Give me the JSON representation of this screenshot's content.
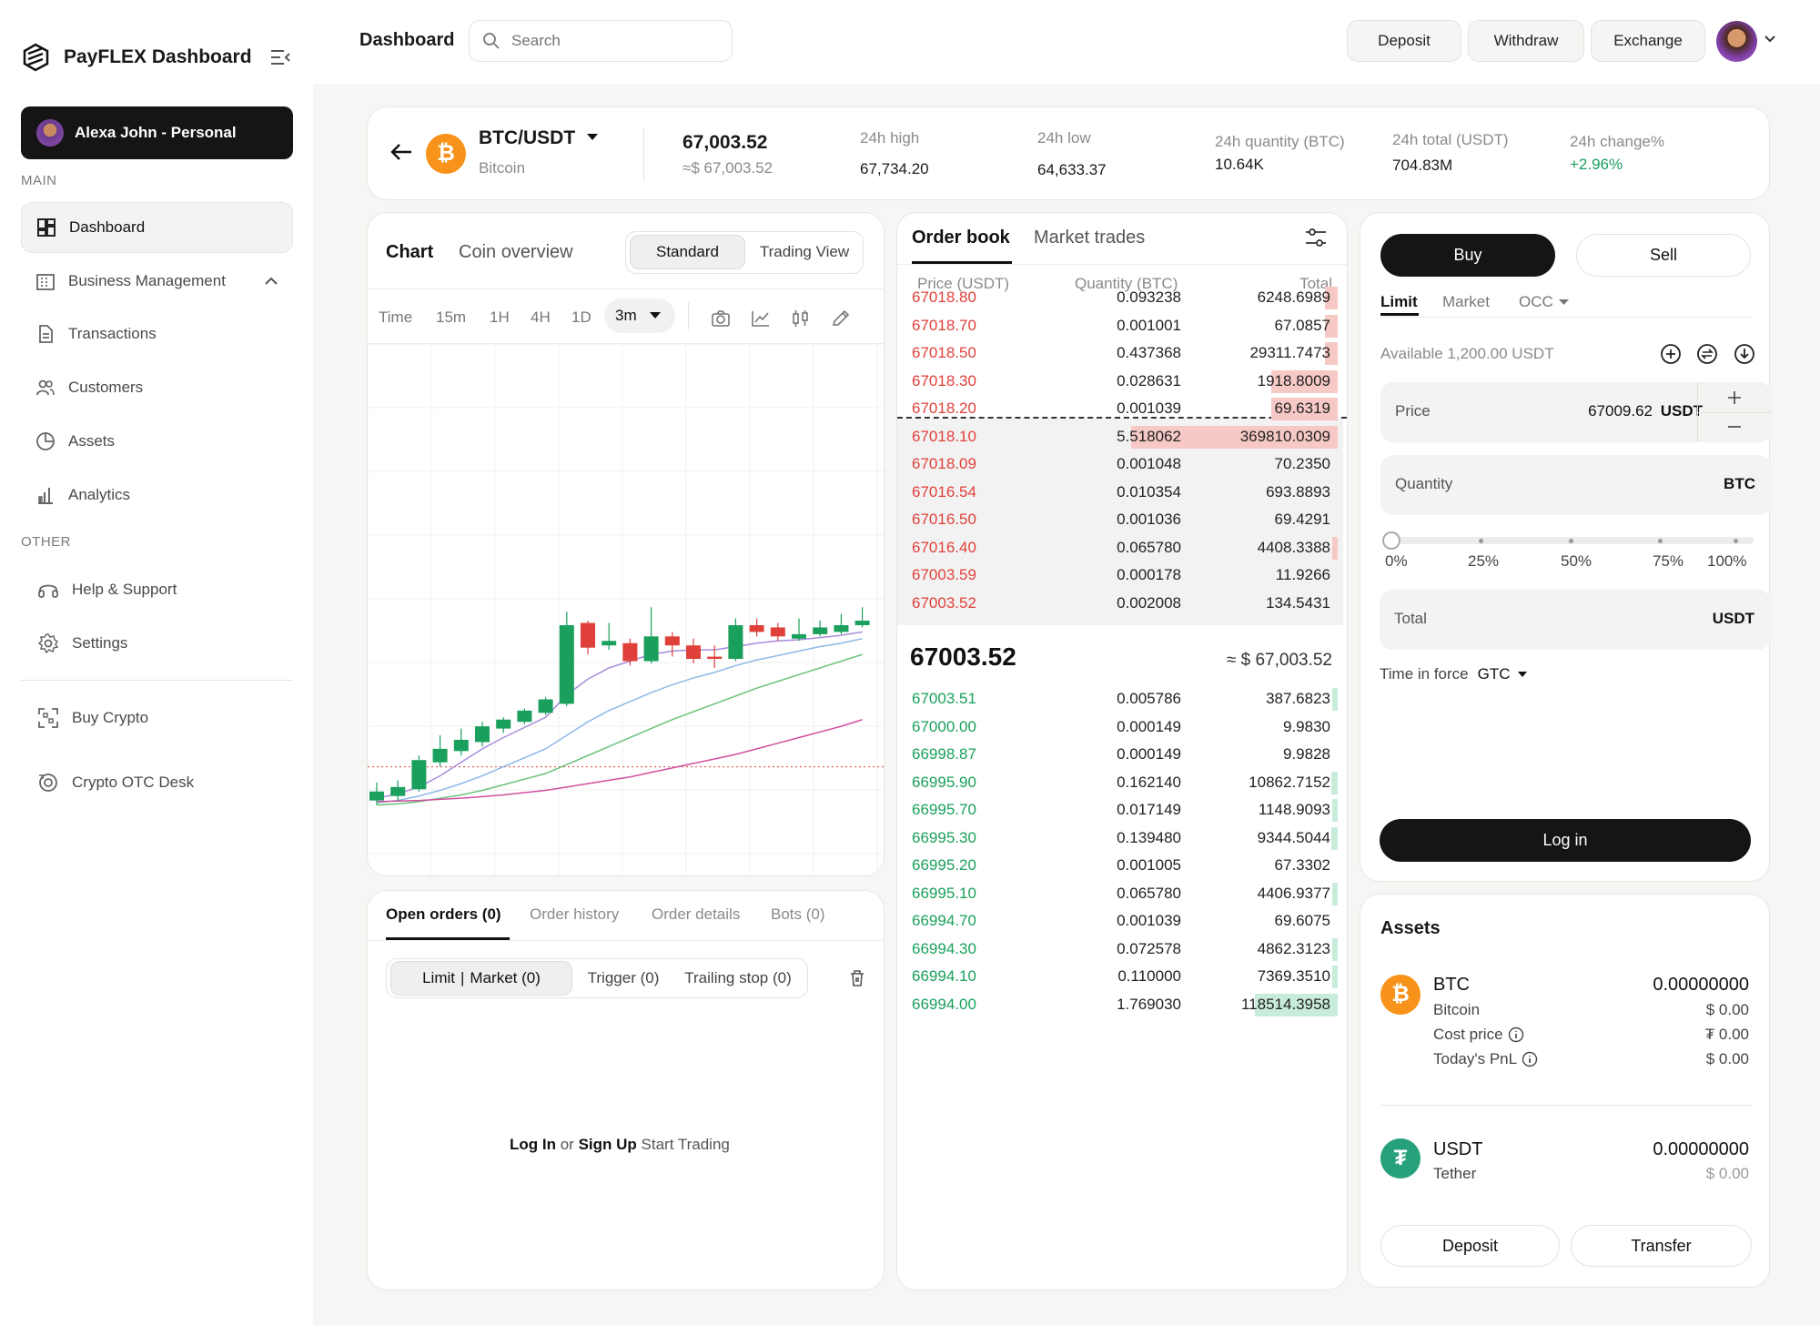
{
  "sidebar": {
    "brand": "PayFLEX Dashboard",
    "profile": "Alexa John - Personal",
    "main_label": "MAIN",
    "items": [
      {
        "label": "Dashboard",
        "icon": "dashboard-icon"
      },
      {
        "label": "Business Management",
        "icon": "building-icon"
      },
      {
        "label": "Transactions",
        "icon": "document-icon"
      },
      {
        "label": "Customers",
        "icon": "users-icon"
      },
      {
        "label": "Assets",
        "icon": "pie-icon"
      },
      {
        "label": "Analytics",
        "icon": "bar-chart-icon"
      }
    ],
    "other_label": "OTHER",
    "other_items": [
      {
        "label": "Help & Support",
        "icon": "headset-icon"
      },
      {
        "label": "Settings",
        "icon": "gear-icon"
      }
    ],
    "extra_items": [
      {
        "label": "Buy Crypto",
        "icon": "scan-icon"
      },
      {
        "label": "Crypto OTC Desk",
        "icon": "otc-icon"
      }
    ]
  },
  "header": {
    "title": "Dashboard",
    "search_placeholder": "Search",
    "deposit": "Deposit",
    "withdraw": "Withdraw",
    "exchange": "Exchange"
  },
  "ticker": {
    "pair": "BTC/USDT",
    "name": "Bitcoin",
    "price": "67,003.52",
    "price_usd": "≈$ 67,003.52",
    "stats": [
      {
        "label": "24h high",
        "value": "67,734.20"
      },
      {
        "label": "24h low",
        "value": "64,633.37"
      },
      {
        "label": "24h quantity (BTC)",
        "value": "10.64K"
      },
      {
        "label": "24h total (USDT)",
        "value": "704.83M"
      },
      {
        "label": "24h change%",
        "value": "+2.96%"
      }
    ]
  },
  "chart_panel": {
    "tab_chart": "Chart",
    "tab_overview": "Coin overview",
    "standard": "Standard",
    "trading_view": "Trading View",
    "timeframes": [
      "Time",
      "15m",
      "1H",
      "4H",
      "1D"
    ],
    "selected_tf": "3m"
  },
  "chart_data": {
    "type": "candlestick",
    "candles": [
      {
        "o": 1.0,
        "c": 1.8,
        "h": 2.6,
        "l": 0.6
      },
      {
        "o": 1.4,
        "c": 2.2,
        "h": 2.8,
        "l": 1.0
      },
      {
        "o": 2.0,
        "c": 4.6,
        "h": 5.0,
        "l": 1.8
      },
      {
        "o": 4.4,
        "c": 5.6,
        "h": 6.8,
        "l": 4.0
      },
      {
        "o": 5.4,
        "c": 6.4,
        "h": 7.4,
        "l": 5.0
      },
      {
        "o": 6.2,
        "c": 7.6,
        "h": 8.0,
        "l": 5.8
      },
      {
        "o": 7.4,
        "c": 8.2,
        "h": 8.4,
        "l": 7.0
      },
      {
        "o": 8.0,
        "c": 9.0,
        "h": 9.2,
        "l": 7.8
      },
      {
        "o": 8.8,
        "c": 10.0,
        "h": 10.2,
        "l": 8.6
      },
      {
        "o": 9.6,
        "c": 16.6,
        "h": 17.8,
        "l": 9.4
      },
      {
        "o": 16.8,
        "c": 14.6,
        "h": 17.0,
        "l": 14.0
      },
      {
        "o": 14.8,
        "c": 15.2,
        "h": 16.8,
        "l": 14.4
      },
      {
        "o": 15.0,
        "c": 13.4,
        "h": 15.4,
        "l": 13.0
      },
      {
        "o": 13.4,
        "c": 15.6,
        "h": 18.2,
        "l": 13.2
      },
      {
        "o": 15.6,
        "c": 14.8,
        "h": 16.0,
        "l": 13.8
      },
      {
        "o": 14.8,
        "c": 13.6,
        "h": 15.4,
        "l": 13.2
      },
      {
        "o": 13.8,
        "c": 13.6,
        "h": 14.8,
        "l": 12.8
      },
      {
        "o": 13.6,
        "c": 16.6,
        "h": 17.2,
        "l": 13.4
      },
      {
        "o": 16.6,
        "c": 16.0,
        "h": 17.2,
        "l": 15.6
      },
      {
        "o": 16.4,
        "c": 15.6,
        "h": 16.8,
        "l": 15.2
      },
      {
        "o": 15.4,
        "c": 15.8,
        "h": 17.2,
        "l": 15.2
      },
      {
        "o": 15.8,
        "c": 16.4,
        "h": 17.0,
        "l": 15.6
      },
      {
        "o": 16.0,
        "c": 16.6,
        "h": 17.6,
        "l": 15.8
      },
      {
        "o": 16.6,
        "c": 17.0,
        "h": 18.2,
        "l": 16.4
      }
    ],
    "ma_series": [
      {
        "color": "#a78bdb",
        "values": [
          1.2,
          1.6,
          2.2,
          3.2,
          4.4,
          5.6,
          6.6,
          7.5,
          8.4,
          10.4,
          11.8,
          12.8,
          13.4,
          14.0,
          14.3,
          14.4,
          14.4,
          14.7,
          15.0,
          15.2,
          15.3,
          15.5,
          15.7,
          16.0
        ]
      },
      {
        "color": "#8fb8e8",
        "values": [
          0.8,
          1.0,
          1.4,
          1.9,
          2.5,
          3.2,
          4.0,
          4.8,
          5.6,
          6.8,
          8.0,
          9.0,
          9.8,
          10.6,
          11.3,
          11.9,
          12.4,
          13.0,
          13.5,
          13.9,
          14.3,
          14.7,
          15.0,
          15.4
        ]
      },
      {
        "color": "#6cc27a",
        "values": [
          0.6,
          0.7,
          0.9,
          1.2,
          1.5,
          1.9,
          2.4,
          2.9,
          3.4,
          4.2,
          5.0,
          5.8,
          6.6,
          7.4,
          8.2,
          8.9,
          9.6,
          10.3,
          11.0,
          11.6,
          12.2,
          12.8,
          13.4,
          14.0
        ]
      },
      {
        "color": "#d14fa0",
        "values": [
          0.9,
          0.95,
          1.0,
          1.1,
          1.2,
          1.35,
          1.5,
          1.7,
          1.9,
          2.2,
          2.5,
          2.8,
          3.1,
          3.5,
          3.9,
          4.3,
          4.7,
          5.1,
          5.6,
          6.1,
          6.6,
          7.1,
          7.6,
          8.2
        ]
      }
    ],
    "price_line": 4.0,
    "ylim": [
      0,
      40
    ]
  },
  "orders_panel": {
    "tabs": [
      "Open orders (0)",
      "Order history",
      "Order details",
      "Bots (0)"
    ],
    "limit": "Limit",
    "market": "Market (0)",
    "trigger": "Trigger (0)",
    "trailing": "Trailing stop (0)",
    "login": "Log In",
    "or": "or",
    "signup": "Sign Up",
    "start": "Start Trading"
  },
  "orderbook": {
    "tab_book": "Order book",
    "tab_trades": "Market trades",
    "col_price": "Price (USDT)",
    "col_qty": "Quantity (BTC)",
    "col_total": "Total",
    "asks": [
      {
        "p": "67018.80",
        "q": "0.093238",
        "t": "6248.6989",
        "depth": 0.03
      },
      {
        "p": "67018.70",
        "q": "0.001001",
        "t": "67.0857",
        "depth": 0.03
      },
      {
        "p": "67018.50",
        "q": "0.437368",
        "t": "29311.7473",
        "depth": 0.03
      },
      {
        "p": "67018.30",
        "q": "0.028631",
        "t": "1918.8009",
        "depth": 0.16
      },
      {
        "p": "67018.20",
        "q": "0.001039",
        "t": "69.6319",
        "depth": 0.16
      },
      {
        "p": "67018.10",
        "q": "5.518062",
        "t": "369810.0309",
        "depth": 0.5
      },
      {
        "p": "67018.09",
        "q": "0.001048",
        "t": "70.2350",
        "depth": 0.0
      },
      {
        "p": "67016.54",
        "q": "0.010354",
        "t": "693.8893",
        "depth": 0.0
      },
      {
        "p": "67016.50",
        "q": "0.001036",
        "t": "69.4291",
        "depth": 0.0
      },
      {
        "p": "67016.40",
        "q": "0.065780",
        "t": "4408.3388",
        "depth": 0.01
      },
      {
        "p": "67003.59",
        "q": "0.000178",
        "t": "11.9266",
        "depth": 0.0
      },
      {
        "p": "67003.52",
        "q": "0.002008",
        "t": "134.5431",
        "depth": 0.0
      }
    ],
    "mid_price": "67003.52",
    "mid_usd": "≈ $ 67,003.52",
    "bids": [
      {
        "p": "67003.51",
        "q": "0.005786",
        "t": "387.6823",
        "depth": 0.005
      },
      {
        "p": "67000.00",
        "q": "0.000149",
        "t": "9.9830",
        "depth": 0.0
      },
      {
        "p": "66998.87",
        "q": "0.000149",
        "t": "9.9828",
        "depth": 0.0
      },
      {
        "p": "66995.90",
        "q": "0.162140",
        "t": "10862.7152",
        "depth": 0.015
      },
      {
        "p": "66995.70",
        "q": "0.017149",
        "t": "1148.9093",
        "depth": 0.01
      },
      {
        "p": "66995.30",
        "q": "0.139480",
        "t": "9344.5044",
        "depth": 0.015
      },
      {
        "p": "66995.20",
        "q": "0.001005",
        "t": "67.3302",
        "depth": 0.0
      },
      {
        "p": "66995.10",
        "q": "0.065780",
        "t": "4406.9377",
        "depth": 0.005
      },
      {
        "p": "66994.70",
        "q": "0.001039",
        "t": "69.6075",
        "depth": 0.0
      },
      {
        "p": "66994.30",
        "q": "0.072578",
        "t": "4862.3123",
        "depth": 0.01
      },
      {
        "p": "66994.10",
        "q": "0.110000",
        "t": "7369.3510",
        "depth": 0.01
      },
      {
        "p": "66994.00",
        "q": "1.769030",
        "t": "118514.3958",
        "depth": 0.2
      }
    ]
  },
  "trade": {
    "buy": "Buy",
    "sell": "Sell",
    "order_tabs": [
      "Limit",
      "Market",
      "OCC"
    ],
    "available": "Available 1,200.00 USDT",
    "price_label": "Price",
    "price_value": "67009.62",
    "price_unit": "USDT",
    "qty_label": "Quantity",
    "qty_unit": "BTC",
    "percents": [
      "0%",
      "25%",
      "50%",
      "75%",
      "100%"
    ],
    "slider_value": 0,
    "total_label": "Total",
    "total_unit": "USDT",
    "tif_label": "Time in force",
    "tif_value": "GTC",
    "login": "Log in"
  },
  "assets": {
    "title": "Assets",
    "btc": {
      "sym": "BTC",
      "name": "Bitcoin",
      "amount": "0.00000000",
      "usd": "$ 0.00",
      "cost_label": "Cost price",
      "cost": "₮ 0.00",
      "pnl_label": "Today's PnL",
      "pnl": "$ 0.00"
    },
    "usdt": {
      "sym": "USDT",
      "name": "Tether",
      "amount": "0.00000000",
      "usd": "$ 0.00"
    },
    "deposit": "Deposit",
    "transfer": "Transfer"
  },
  "colors": {
    "ask": "#e0403a",
    "bid": "#1aa05c",
    "accent": "#151515",
    "btc": "#f7931a",
    "usdt": "#26a17b"
  }
}
